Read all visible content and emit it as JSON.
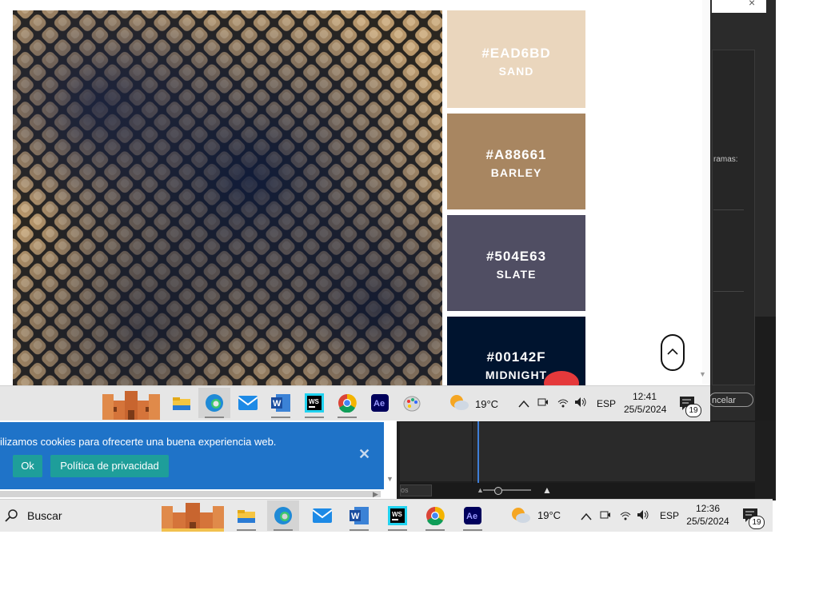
{
  "colors": {
    "sand": "#EAD6BD",
    "barley": "#A88661",
    "slate": "#504E63",
    "midnight": "#00142F",
    "cookie_banner": "#1f73c8",
    "cookie_button": "#1e9e9a",
    "pin_red": "#e5393b"
  },
  "palette": [
    {
      "hex": "#EAD6BD",
      "name": "SAND",
      "bg": "#EAD6BD",
      "fg": "#ffffff"
    },
    {
      "hex": "#A88661",
      "name": "BARLEY",
      "bg": "#A88661",
      "fg": "#ffffff"
    },
    {
      "hex": "#504E63",
      "name": "SLATE",
      "bg": "#504E63",
      "fg": "#ffffff"
    },
    {
      "hex": "#00142F",
      "name": "MIDNIGHT",
      "bg": "#00142F",
      "fg": "#ffffff"
    }
  ],
  "dark_app": {
    "label_partial": "ramas:",
    "cancel_partial": "ncelar"
  },
  "editor": {
    "input_partial": "os"
  },
  "cookie": {
    "text": "ilizamos cookies para ofrecerte una buena experiencia web.",
    "ok_label": "Ok",
    "privacy_label": "Política de privacidad"
  },
  "taskbar_top": {
    "temperature": "19°C",
    "language": "ESP",
    "time": "12:41",
    "date": "25/5/2024",
    "notifications": "19"
  },
  "taskbar_bottom": {
    "search_label": "Buscar",
    "temperature": "19°C",
    "language": "ESP",
    "time": "12:36",
    "date": "25/5/2024",
    "notifications": "19"
  },
  "icons": [
    "weather-icon",
    "chevron-up-icon",
    "meet-now-icon",
    "wifi-icon",
    "volume-icon",
    "notification-icon",
    "search-icon",
    "file-explorer-icon",
    "edge-icon",
    "mail-icon",
    "word-icon",
    "webstorm-icon",
    "chrome-icon",
    "after-effects-icon",
    "paint-icon",
    "castle-widget-icon"
  ]
}
